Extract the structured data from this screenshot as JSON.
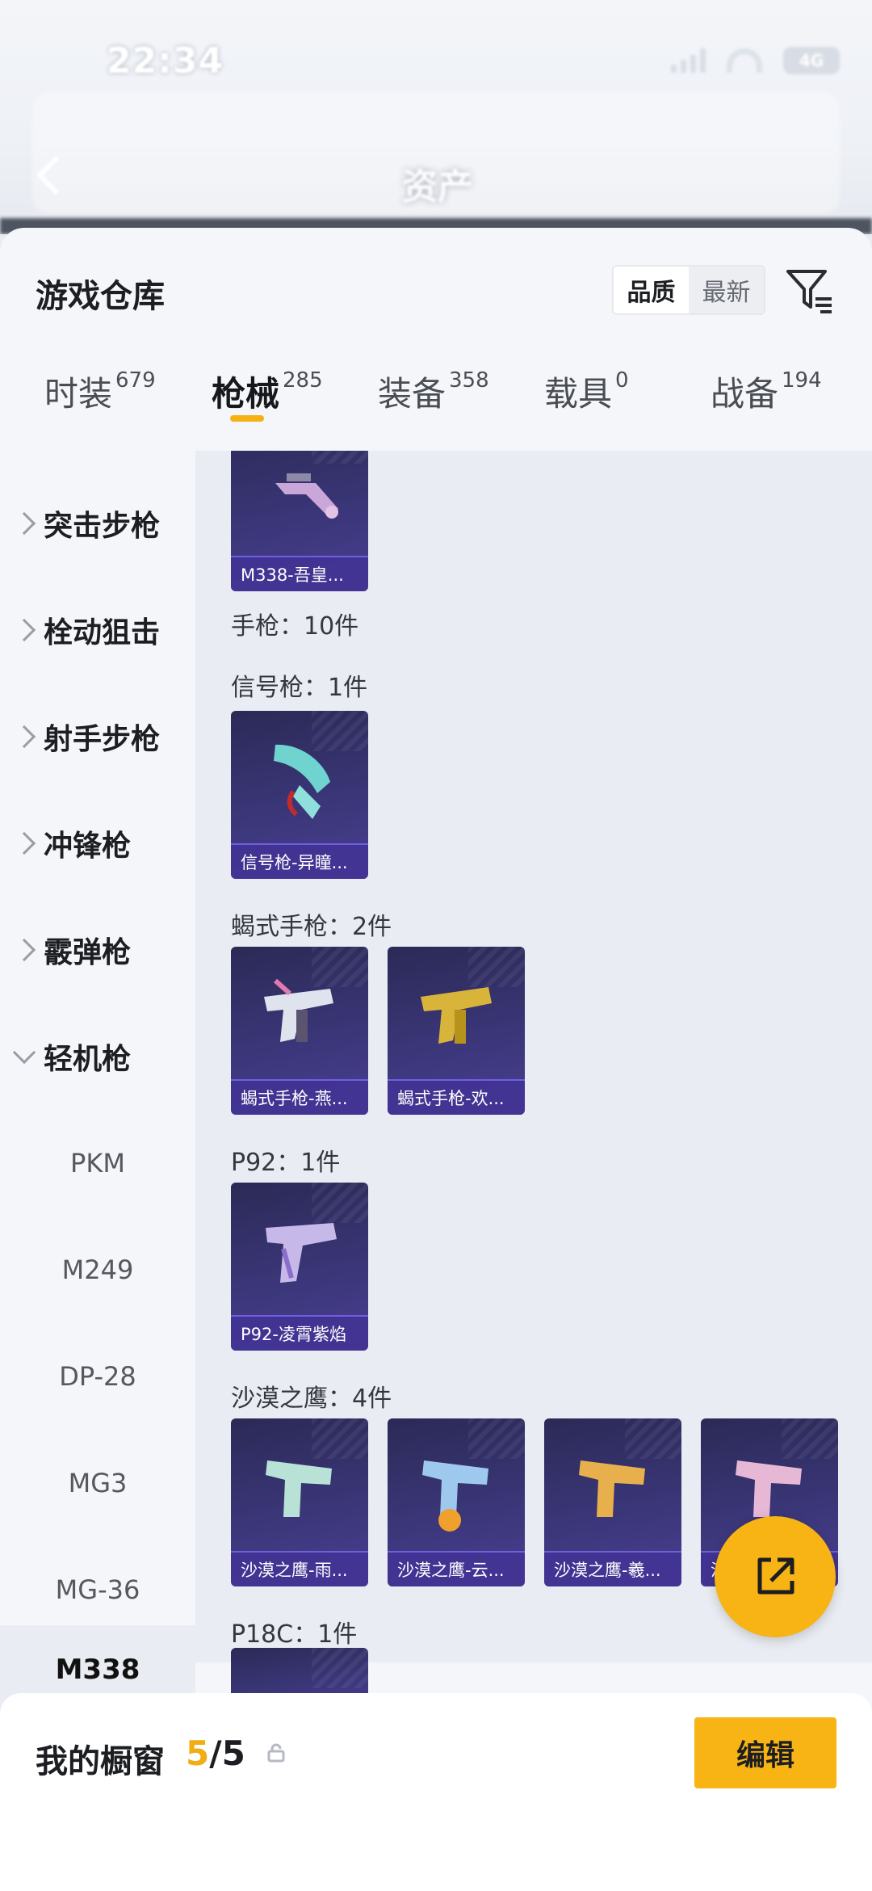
{
  "status_bar": {
    "time": "22:34",
    "battery": "4G"
  },
  "app_header": {
    "title": "资产"
  },
  "sheet": {
    "title": "游戏仓库",
    "sort_options": [
      "品质",
      "最新"
    ],
    "active_sort": "品质"
  },
  "tabs": [
    {
      "label": "时装",
      "count": "679"
    },
    {
      "label": "枪械",
      "count": "285"
    },
    {
      "label": "装备",
      "count": "358"
    },
    {
      "label": "载具",
      "count": "0"
    },
    {
      "label": "战备",
      "count": "194"
    }
  ],
  "active_tab": "枪械",
  "sidebar": {
    "categories": [
      "突击步枪",
      "栓动狙击",
      "射手步枪",
      "冲锋枪",
      "霰弹枪",
      "轻机枪"
    ],
    "subitems": [
      "PKM",
      "M249",
      "DP-28",
      "MG3",
      "MG-36",
      "M338"
    ],
    "selected": "M338"
  },
  "content": {
    "top_card": "M338-吾皇...",
    "groups": [
      {
        "label": "手枪：10件"
      },
      {
        "label": "信号枪：1件",
        "cards": [
          "信号枪-异瞳..."
        ]
      },
      {
        "label": "蝎式手枪：2件",
        "cards": [
          "蝎式手枪-燕...",
          "蝎式手枪-欢..."
        ]
      },
      {
        "label": "P92：1件",
        "cards": [
          "P92-凌霄紫焰"
        ]
      },
      {
        "label": "沙漠之鹰：4件",
        "cards": [
          "沙漠之鹰-雨...",
          "沙漠之鹰-云...",
          "沙漠之鹰-羲...",
          "沙"
        ]
      },
      {
        "label": "P18C：1件"
      }
    ]
  },
  "bottom_bar": {
    "label": "我的橱窗",
    "count_used": "5",
    "count_sep_total": "/5",
    "edit_label": "编辑"
  },
  "colors": {
    "accent": "#f7b414",
    "card_bg": "#3a3678",
    "caption_border": "#6f5fe0"
  }
}
